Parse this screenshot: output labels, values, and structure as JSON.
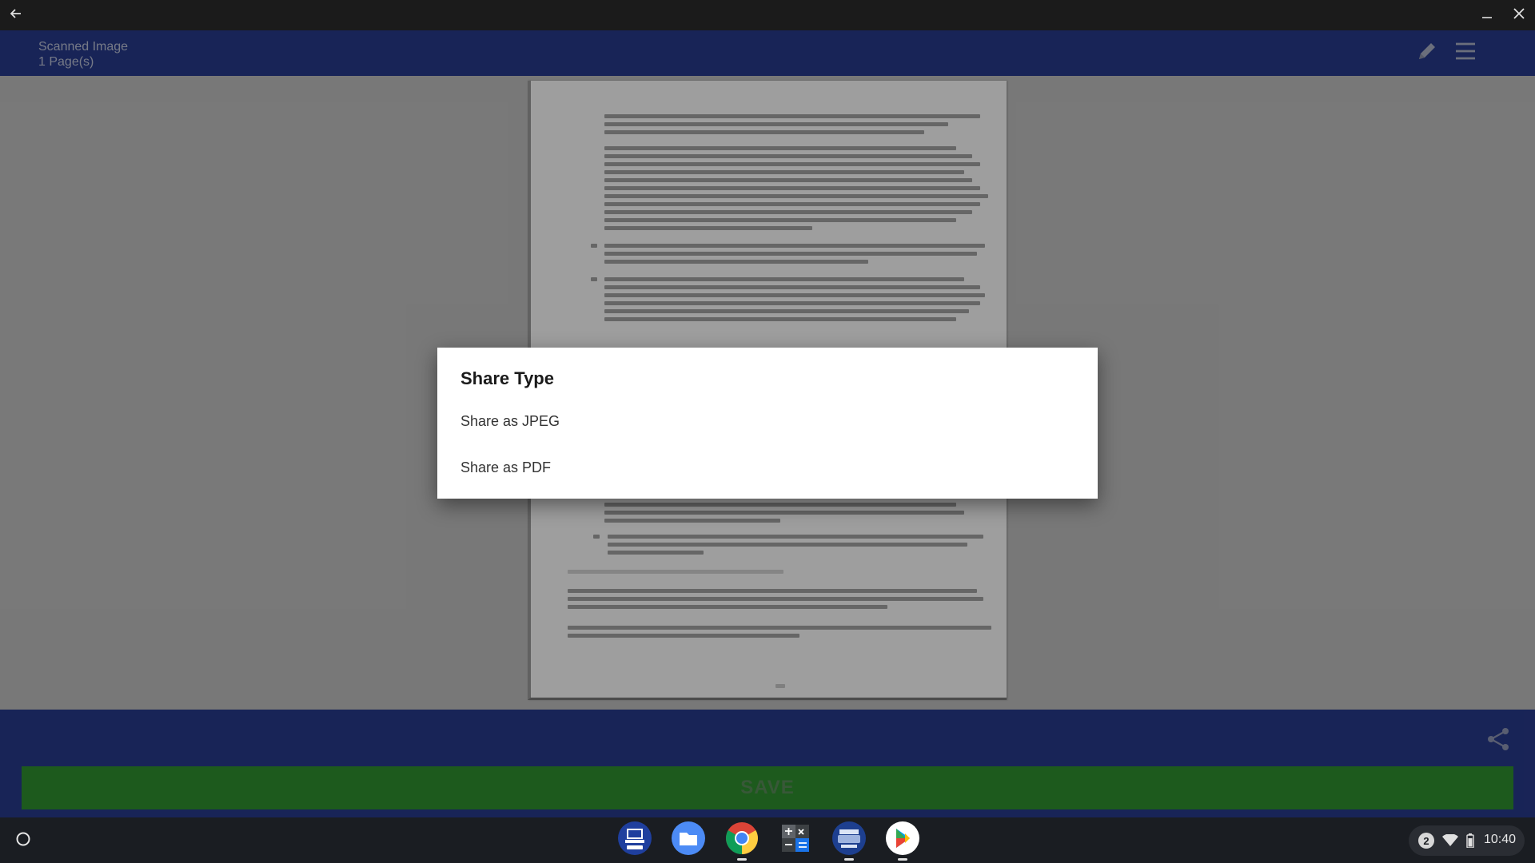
{
  "window": {
    "back_icon": "arrow-left-icon",
    "minimize_icon": "minimize-icon",
    "close_icon": "close-icon"
  },
  "header": {
    "title": "Scanned Image",
    "subtitle": "1 Page(s)",
    "edit_icon": "pencil-icon",
    "menu_icon": "hamburger-menu-icon"
  },
  "dialog": {
    "title": "Share Type",
    "options": [
      "Share as JPEG",
      "Share as PDF"
    ]
  },
  "bottom": {
    "share_icon": "share-icon",
    "save_label": "SAVE"
  },
  "shelf": {
    "launcher_icon": "launcher-circle-icon",
    "apps": [
      "Epson app",
      "Files",
      "Chrome",
      "Calculator",
      "Brother app",
      "Play Store"
    ],
    "tray_notification_count": "2",
    "time": "10:40"
  },
  "colors": {
    "header": "#27398a",
    "save_button": "#2f8f2f",
    "content_bg": "#bfbfbf",
    "titlebar": "#1b1b1b",
    "shelf": "#1a1d22"
  }
}
